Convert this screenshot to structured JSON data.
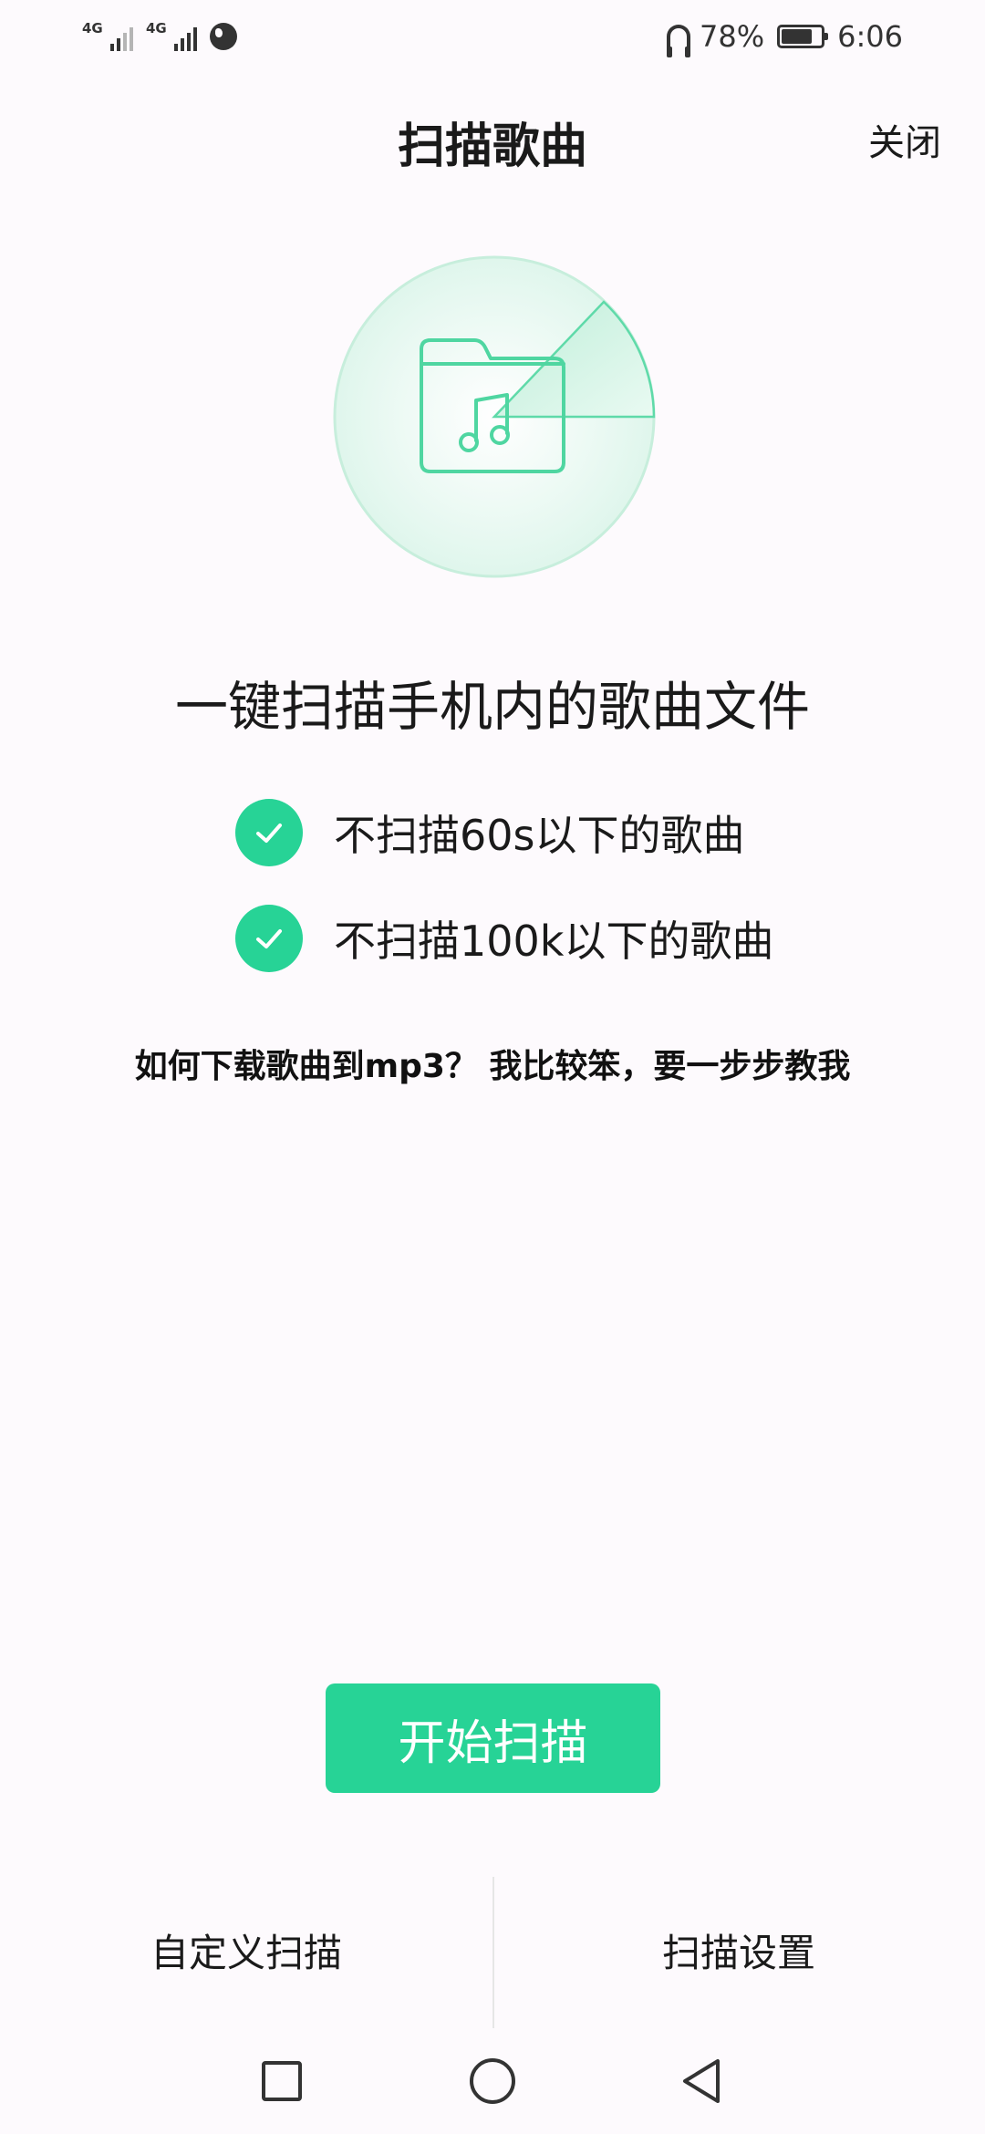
{
  "status_bar": {
    "sim1_network": "4G",
    "sim2_network": "4G",
    "battery_percent": "78%",
    "battery_level": 0.78,
    "time": "6:06",
    "icons": [
      "signal-icon",
      "signal-icon",
      "globe-icon",
      "headphone-icon",
      "battery-icon"
    ]
  },
  "header": {
    "title": "扫描歌曲",
    "close_label": "关闭"
  },
  "hero": {
    "icon": "music-folder-icon",
    "accent_color": "#27d396"
  },
  "main": {
    "headline": "一键扫描手机内的歌曲文件",
    "rules": [
      {
        "text": "不扫描60s以下的歌曲",
        "checked": true
      },
      {
        "text": "不扫描100k以下的歌曲",
        "checked": true
      }
    ],
    "question": "如何下载歌曲到mp3？ 我比较笨，要一步步教我"
  },
  "actions": {
    "start_label": "开始扫描",
    "custom_scan_label": "自定义扫描",
    "scan_settings_label": "扫描设置"
  },
  "nav_bar": {
    "icons": [
      "recent-apps-icon",
      "home-icon",
      "back-icon"
    ]
  },
  "colors": {
    "accent": "#27d396",
    "background": "#fdfafd",
    "text": "#1a1a1a"
  }
}
